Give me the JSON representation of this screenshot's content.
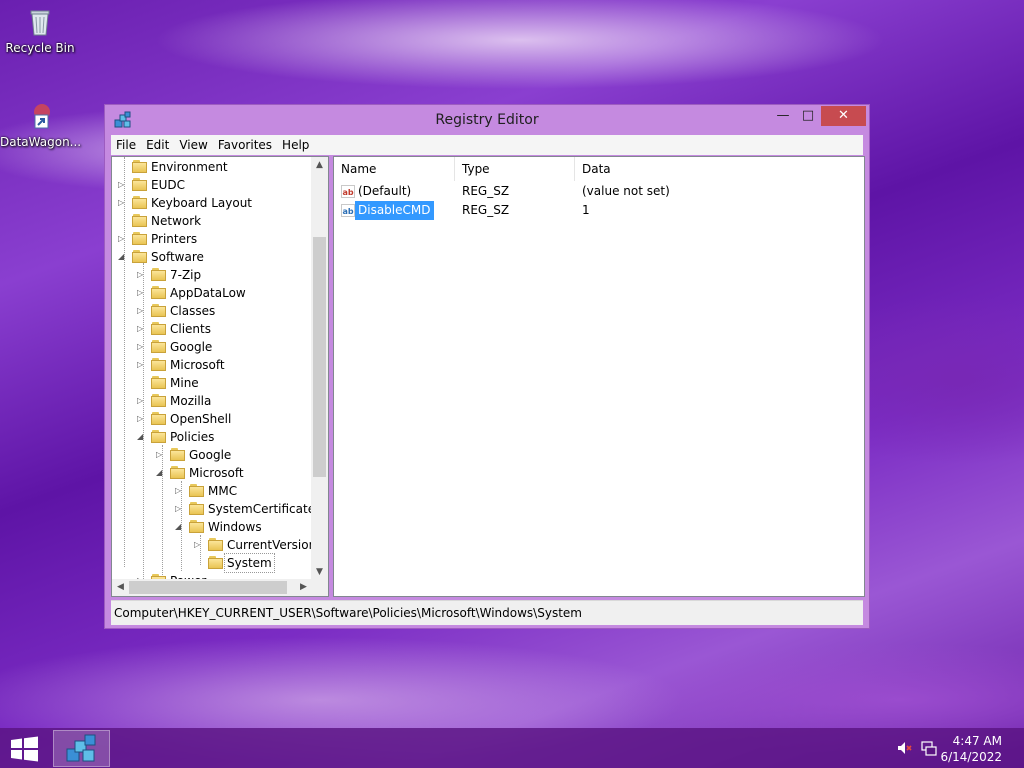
{
  "desktop": {
    "icons": [
      {
        "label": "Recycle Bin",
        "icon": "recycle-bin-icon"
      },
      {
        "label": "DataWagon...",
        "icon": "shortcut-icon"
      }
    ]
  },
  "window": {
    "title": "Registry Editor",
    "controls": {
      "minimize": "—",
      "maximize": "□",
      "close": "✕"
    },
    "menu": [
      "File",
      "Edit",
      "View",
      "Favorites",
      "Help"
    ],
    "tree": [
      {
        "label": "Environment",
        "expander": ""
      },
      {
        "label": "EUDC",
        "expander": "▷"
      },
      {
        "label": "Keyboard Layout",
        "expander": "▷"
      },
      {
        "label": "Network",
        "expander": ""
      },
      {
        "label": "Printers",
        "expander": "▷"
      },
      {
        "label": "Software",
        "expander": "◢"
      },
      {
        "label": "7-Zip",
        "expander": "▷"
      },
      {
        "label": "AppDataLow",
        "expander": "▷"
      },
      {
        "label": "Classes",
        "expander": "▷"
      },
      {
        "label": "Clients",
        "expander": "▷"
      },
      {
        "label": "Google",
        "expander": "▷"
      },
      {
        "label": "Microsoft",
        "expander": "▷"
      },
      {
        "label": "Mine",
        "expander": ""
      },
      {
        "label": "Mozilla",
        "expander": "▷"
      },
      {
        "label": "OpenShell",
        "expander": "▷"
      },
      {
        "label": "Policies",
        "expander": "◢"
      },
      {
        "label": "Google",
        "expander": "▷"
      },
      {
        "label": "Microsoft",
        "expander": "◢"
      },
      {
        "label": "MMC",
        "expander": "▷"
      },
      {
        "label": "SystemCertificates",
        "expander": "▷"
      },
      {
        "label": "Windows",
        "expander": "◢"
      },
      {
        "label": "CurrentVersion",
        "expander": "▷"
      },
      {
        "label": "System",
        "expander": ""
      },
      {
        "label": "Power",
        "expander": "▷"
      }
    ],
    "list": {
      "columns": [
        "Name",
        "Type",
        "Data"
      ],
      "rows": [
        {
          "name": "(Default)",
          "type": "REG_SZ",
          "data": "(value not set)",
          "icon": "ab"
        },
        {
          "name": "DisableCMD",
          "type": "REG_SZ",
          "data": "1",
          "icon": "ab"
        }
      ]
    },
    "status": "Computer\\HKEY_CURRENT_USER\\Software\\Policies\\Microsoft\\Windows\\System"
  },
  "taskbar": {
    "time": "4:47 AM",
    "date": "6/14/2022",
    "tray": [
      "volume-muted-icon",
      "network-icon"
    ]
  },
  "colors": {
    "selection": "#3399ff",
    "close_button": "#c74b50",
    "window_frame": "#c58ae0"
  }
}
